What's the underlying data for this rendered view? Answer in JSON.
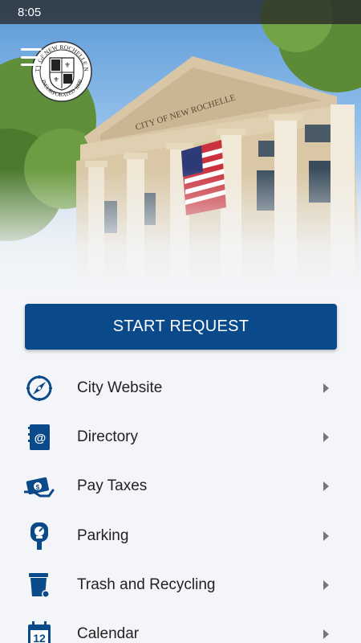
{
  "status_bar": {
    "time": "8:05"
  },
  "header": {
    "building_inscription": "CITY OF NEW ROCHELLE",
    "seal": {
      "top_text": "CITY OF NEW ROCHELLE N.Y.",
      "bottom_text": "INCORPORATED 1899"
    },
    "menu_icon": "hamburger-icon"
  },
  "start_request": {
    "label": "START REQUEST"
  },
  "colors": {
    "primary": "#0b4a8a",
    "icon": "#0b4a8a",
    "background": "#f3f5f8",
    "chevron": "#777777"
  },
  "menu": {
    "items": [
      {
        "label": "City Website",
        "icon": "compass-icon"
      },
      {
        "label": "Directory",
        "icon": "address-book-icon"
      },
      {
        "label": "Pay Taxes",
        "icon": "cash-payment-icon"
      },
      {
        "label": "Parking",
        "icon": "parking-meter-icon"
      },
      {
        "label": "Trash and Recycling",
        "icon": "trash-bin-icon"
      },
      {
        "label": "Calendar",
        "icon": "calendar-icon"
      }
    ]
  }
}
